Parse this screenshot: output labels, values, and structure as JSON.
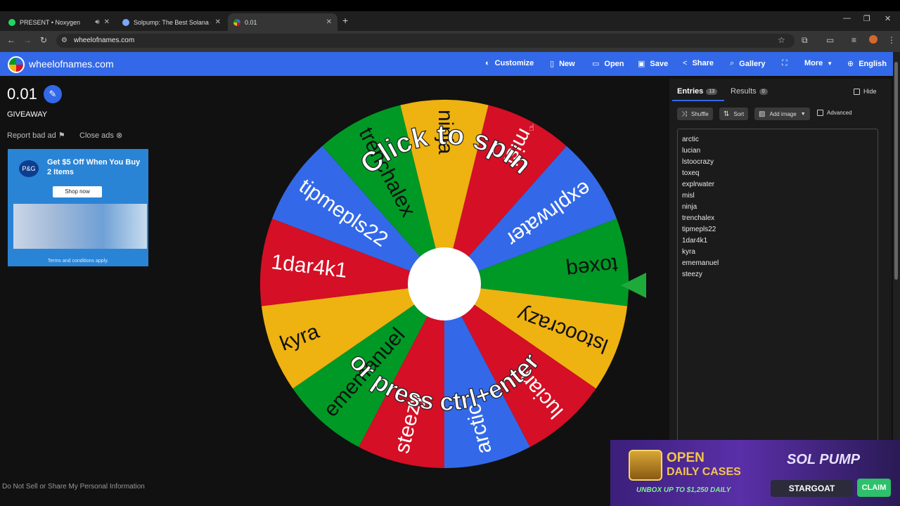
{
  "browser": {
    "tabs": [
      {
        "label": "PRESENT • Noxygen",
        "favicon_color": "#1ed760"
      },
      {
        "label": "Solpump: The Best Solana Casi",
        "favicon_color": "#7aa7ff"
      },
      {
        "label": "0.01",
        "favicon_color": "#d50f25"
      }
    ],
    "new_tab": "+",
    "url": "wheelofnames.com"
  },
  "site": {
    "name": "wheelofnames.com",
    "menu": [
      {
        "label": "Customize",
        "icon": "palette-icon"
      },
      {
        "label": "New",
        "icon": "file-icon"
      },
      {
        "label": "Open",
        "icon": "folder-icon"
      },
      {
        "label": "Save",
        "icon": "save-icon"
      },
      {
        "label": "Share",
        "icon": "share-icon"
      },
      {
        "label": "Gallery",
        "icon": "search-icon"
      },
      {
        "label": "More",
        "icon": "chevron-down-icon"
      },
      {
        "label": "English",
        "icon": "globe-icon"
      }
    ],
    "colors": {
      "brand": "#3369e8",
      "blue": "#3369e8",
      "red": "#d50f25",
      "yellow": "#eeb211",
      "green": "#009925"
    }
  },
  "left": {
    "title": "0.01",
    "subtitle": "GIVEAWAY",
    "report_ad": "Report bad ad",
    "close_ads": "Close ads",
    "footer": "Do Not Sell or Share My Personal Information"
  },
  "ad": {
    "brand": "P&G",
    "headline": "Get $5 Off When You Buy 2 Items",
    "button": "Shop now",
    "terms": "Terms and conditions apply."
  },
  "wheel": {
    "line1": "Click to spin",
    "line2": "or press ctrl+enter",
    "segments": [
      {
        "name": "ninja",
        "color": "#eeb211"
      },
      {
        "name": "misl",
        "color": "#d50f25"
      },
      {
        "name": "explrwater",
        "color": "#3369e8"
      },
      {
        "name": "toxeq",
        "color": "#009925"
      },
      {
        "name": "lstoocrazy",
        "color": "#eeb211"
      },
      {
        "name": "lucian",
        "color": "#d50f25"
      },
      {
        "name": "arctic",
        "color": "#3369e8"
      },
      {
        "name": "steezy",
        "color": "#d50f25"
      },
      {
        "name": "ememanuel",
        "color": "#009925"
      },
      {
        "name": "kyra",
        "color": "#eeb211"
      },
      {
        "name": "1dar4k1",
        "color": "#d50f25"
      },
      {
        "name": "tipmepls22",
        "color": "#3369e8"
      },
      {
        "name": "trenchalex",
        "color": "#009925"
      }
    ]
  },
  "panel": {
    "entries_tab": "Entries",
    "entries_count": "13",
    "results_tab": "Results",
    "results_count": "0",
    "hide": "Hide",
    "shuffle": "Shuffle",
    "sort": "Sort",
    "add_image": "Add image",
    "advanced": "Advanced",
    "entries": [
      "arctic",
      "lucian",
      "lstoocrazy",
      "toxeq",
      "explrwater",
      "misl",
      "ninja",
      "trenchalex",
      "tipmepls22",
      "1dar4k1",
      "kyra",
      "ememanuel",
      "steezy"
    ]
  },
  "banner": {
    "open": "OPEN",
    "daily_cases": "DAILY CASES",
    "unbox": "UNBOX UP TO $1,250 DAILY",
    "brand": "SOL PUMP",
    "user": "STARGOAT",
    "claim": "CLAIM"
  }
}
